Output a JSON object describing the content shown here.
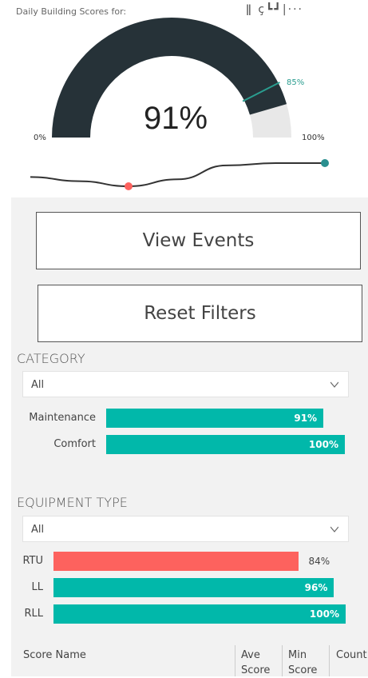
{
  "header": {
    "title": "Daily Building Scores for:",
    "icons_text": "ǁ ç┗┛|···"
  },
  "gauge": {
    "value_label": "91%",
    "value": 0.91,
    "min_label": "0%",
    "max_label": "100%",
    "target_label": "85%",
    "target": 0.85,
    "fill_color": "#263238",
    "track_color": "#e8e8e8",
    "target_color": "#2a9d8f"
  },
  "sparkline": {
    "values": [
      0.4,
      0.22,
      0.0,
      0.3,
      0.9,
      1.0,
      1.0
    ],
    "line_color": "#333333",
    "low_marker_color": "#fd625e",
    "end_marker_color": "#2a8f8f"
  },
  "buttons": {
    "view_events": "View Events",
    "reset_filters": "Reset Filters"
  },
  "category": {
    "title": "CATEGORY",
    "dropdown_value": "All",
    "bars": [
      {
        "label": "Maintenance",
        "value": 91,
        "value_label": "91%",
        "color": "#01b8aa"
      },
      {
        "label": "Comfort",
        "value": 100,
        "value_label": "100%",
        "color": "#01b8aa"
      }
    ]
  },
  "equipment": {
    "title": "EQUIPMENT TYPE",
    "dropdown_value": "All",
    "bars": [
      {
        "label": "RTU",
        "value": 84,
        "value_label": "84%",
        "color": "#fd625e"
      },
      {
        "label": "LL",
        "value": 96,
        "value_label": "96%",
        "color": "#01b8aa"
      },
      {
        "label": "RLL",
        "value": 100,
        "value_label": "100%",
        "color": "#01b8aa"
      }
    ]
  },
  "table": {
    "headers": [
      "Score Name",
      "Ave Score",
      "Min Score",
      "Count"
    ]
  }
}
